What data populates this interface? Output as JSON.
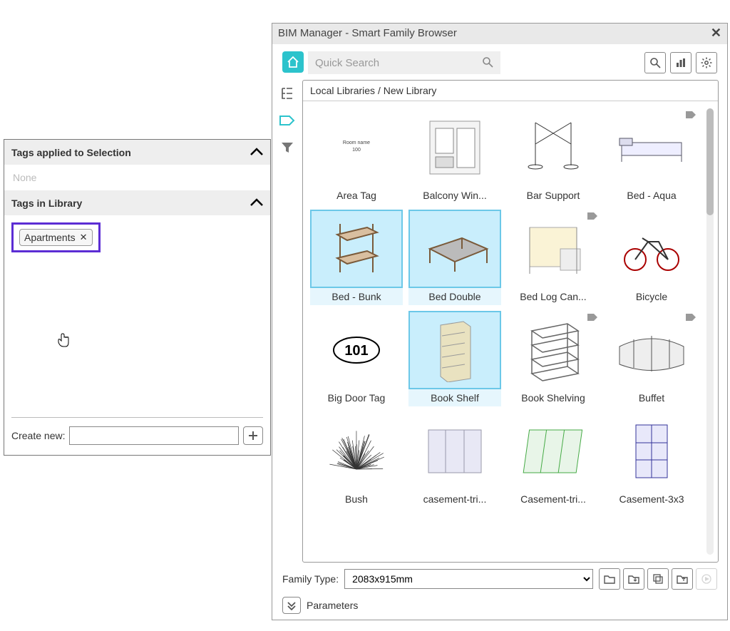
{
  "tagsPanel": {
    "section1": "Tags applied to Selection",
    "none": "None",
    "section2": "Tags in Library",
    "tagChip": "Apartments",
    "createLabel": "Create new:"
  },
  "window": {
    "title": "BIM Manager - Smart Family Browser",
    "searchPlaceholder": "Quick Search",
    "breadcrumb": "Local Libraries / New Library",
    "familyTypeLabel": "Family Type:",
    "familyTypeValue": "2083x915mm",
    "paramsLabel": "Parameters"
  },
  "items": [
    {
      "label": "Area Tag",
      "selected": false,
      "tagged": false,
      "kind": "areatag"
    },
    {
      "label": "Balcony Win...",
      "selected": false,
      "tagged": false,
      "kind": "balcony"
    },
    {
      "label": "Bar Support",
      "selected": false,
      "tagged": false,
      "kind": "barsupport"
    },
    {
      "label": "Bed - Aqua",
      "selected": false,
      "tagged": true,
      "kind": "bedaqua"
    },
    {
      "label": "Bed - Bunk",
      "selected": true,
      "tagged": false,
      "kind": "bunk"
    },
    {
      "label": "Bed Double",
      "selected": true,
      "tagged": false,
      "kind": "double"
    },
    {
      "label": "Bed Log Can...",
      "selected": false,
      "tagged": true,
      "kind": "canopy"
    },
    {
      "label": "Bicycle",
      "selected": false,
      "tagged": false,
      "kind": "bicycle"
    },
    {
      "label": "Big Door Tag",
      "selected": false,
      "tagged": false,
      "kind": "doortag"
    },
    {
      "label": "Book Shelf",
      "selected": true,
      "tagged": false,
      "kind": "bookshelf"
    },
    {
      "label": "Book Shelving",
      "selected": false,
      "tagged": true,
      "kind": "shelving"
    },
    {
      "label": "Buffet",
      "selected": false,
      "tagged": true,
      "kind": "buffet"
    },
    {
      "label": "Bush",
      "selected": false,
      "tagged": false,
      "kind": "bush"
    },
    {
      "label": "casement-tri...",
      "selected": false,
      "tagged": false,
      "kind": "casement1"
    },
    {
      "label": "Casement-tri...",
      "selected": false,
      "tagged": false,
      "kind": "casement2"
    },
    {
      "label": "Casement-3x3",
      "selected": false,
      "tagged": false,
      "kind": "casement3"
    }
  ]
}
